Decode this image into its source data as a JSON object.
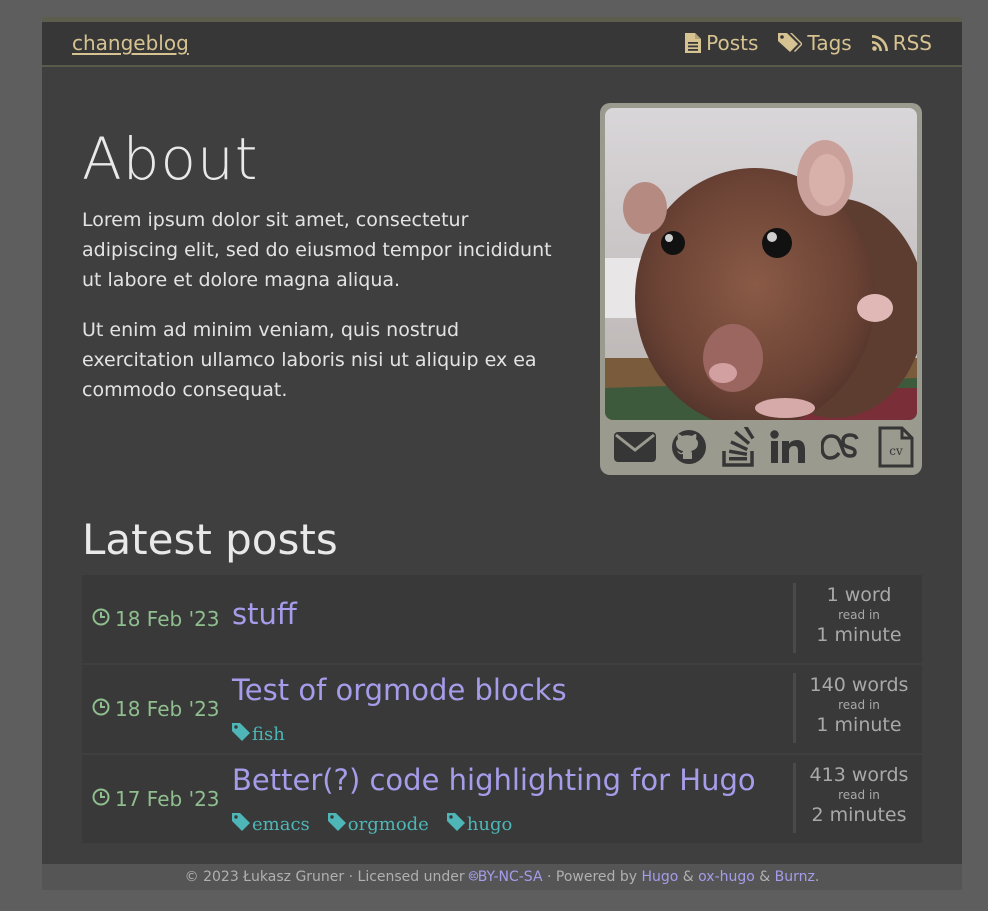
{
  "header": {
    "site_title": "changeblog",
    "nav": [
      {
        "label": "Posts",
        "icon": "file-text-icon"
      },
      {
        "label": "Tags",
        "icon": "tags-icon"
      },
      {
        "label": "RSS",
        "icon": "rss-icon"
      }
    ]
  },
  "about": {
    "title": "About",
    "paragraphs": [
      "Lorem ipsum dolor sit amet, consectetur adipiscing elit, sed do eiusmod tempor incididunt ut labore et dolore magna aliqua.",
      "Ut enim ad minim veniam, quis nostrud exercitation ullamco laboris nisi ut aliquip ex ea commodo consequat."
    ],
    "socials": [
      "envelope-icon",
      "github-icon",
      "stackoverflow-icon",
      "linkedin-icon",
      "lastfm-icon",
      "cv-icon"
    ],
    "cv_label": "CV"
  },
  "latest": {
    "title": "Latest posts",
    "posts": [
      {
        "date": "18 Feb '23",
        "title": "stuff",
        "tags": [],
        "words": "1 word",
        "read_in": "read in",
        "minutes": "1 minute"
      },
      {
        "date": "18 Feb '23",
        "title": "Test of orgmode blocks",
        "tags": [
          "fish"
        ],
        "words": "140 words",
        "read_in": "read in",
        "minutes": "1 minute"
      },
      {
        "date": "17 Feb '23",
        "title": "Better(?) code highlighting for Hugo",
        "tags": [
          "emacs",
          "orgmode",
          "hugo"
        ],
        "words": "413 words",
        "read_in": "read in",
        "minutes": "2 minutes"
      }
    ]
  },
  "footer": {
    "copyright": "© 2023 Łukasz Gruner · Licensed under ",
    "license": "BY-NC-SA",
    "powered": " · Powered by ",
    "hugo": "Hugo",
    "amp1": " & ",
    "oxhugo": "ox-hugo",
    "amp2": " & ",
    "burnz": "Burnz",
    "end": "."
  },
  "colors": {
    "accent": "#d6c391",
    "post_title": "#a59cea",
    "date": "#8fbf8f",
    "tag": "#4eb6b6"
  }
}
